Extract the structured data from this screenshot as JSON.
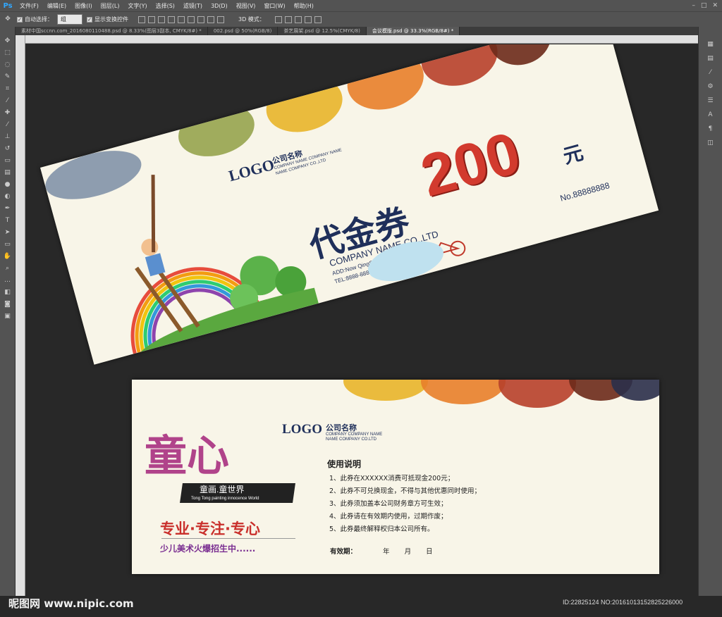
{
  "app": {
    "logo": "Ps"
  },
  "menu": [
    "文件(F)",
    "编辑(E)",
    "图像(I)",
    "图层(L)",
    "文字(Y)",
    "选择(S)",
    "滤镜(T)",
    "3D(D)",
    "视图(V)",
    "窗口(W)",
    "帮助(H)"
  ],
  "options": {
    "auto_select_label": "自动选择：",
    "auto_select_value": "组",
    "show_transform_label": "显示变换控件",
    "mode_3d": "3D 模式："
  },
  "tabs": [
    "素材中国sccnn.com_2016080110488.psd @ 8.33%(图层3副本, CMYK/8#) *",
    "002.psd @ 50%(RGB/8)",
    "茶艺展架.psd @ 12.5%(CMYK/8)",
    "会议模版.psd @ 33.3%(RGB/8#) *"
  ],
  "voucher_front": {
    "logo": "LOGO",
    "company_cn": "公司名称",
    "company_en1": "COMPANY NAME COMPANY NAME",
    "company_en2": "NAME COMPANY CO.,LTD",
    "title": "代金券",
    "amount": "200",
    "unit": "元",
    "serial": "No.88888888",
    "company_name": "COMPANY NAME CO.,LTD",
    "address": "ADD:Now QingShanHu area.No.chang",
    "phone": "TEL:8888-88888888   FAX:8888-88888888"
  },
  "voucher_back": {
    "logo": "LOGO",
    "company_cn": "公司名称",
    "company_en1": "COMPANY COMPANY NAME",
    "company_en2": "NAME COMPANY CO.LTD",
    "brand_big": "童心",
    "brand_sub": "童画.童世界",
    "brand_en": "Tong Tong painting innocence World",
    "slogan": "专业·专注·专心",
    "recruit": "少儿美术火爆招生中......",
    "notes_title": "使用说明",
    "notes": [
      "1、此券在XXXXXX消费可抵现金200元；",
      "2、此券不可兑换现金，不得与其他优惠同时使用；",
      "3、此券须加盖本公司财务章方可生效；",
      "4、此券请在有效期内使用，过期作废；",
      "5、此券最终解释权归本公司所有。"
    ],
    "validity_label": "有效期：",
    "validity_year": "年",
    "validity_month": "月",
    "validity_day": "日"
  },
  "watermark": {
    "site": "昵图网 www.nipic.com",
    "id": "ID:22825124 NO:20161013152825226000"
  },
  "colors": {
    "navy": "#1f2f5a",
    "red": "#d23a2e",
    "purple": "#9b3b8c",
    "paper": "#f8f5e8"
  }
}
